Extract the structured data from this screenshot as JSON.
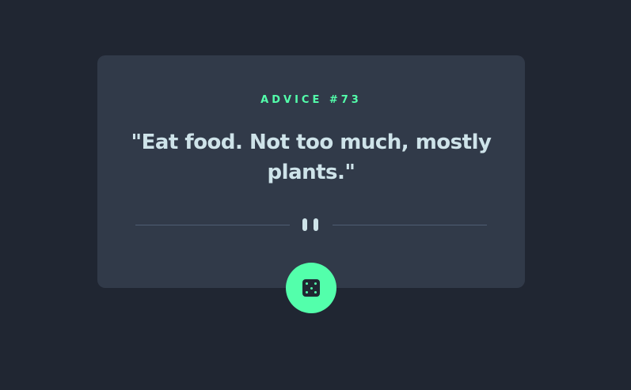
{
  "advice": {
    "id_label": "ADVICE #73",
    "quote": "\"Eat food. Not too much, mostly plants.\""
  },
  "divider": {
    "icon": "pause-icon"
  },
  "dice_button": {
    "icon": "dice-icon"
  },
  "colors": {
    "background": "#202632",
    "card": "#313a49",
    "accent": "#53ffab",
    "text": "#cee3e9",
    "divider": "#4e5d73"
  }
}
